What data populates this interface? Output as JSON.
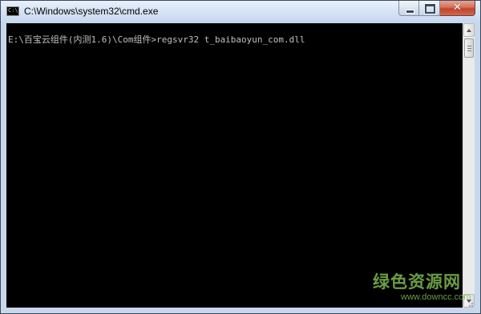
{
  "window": {
    "title": "C:\\Windows\\system32\\cmd.exe",
    "icon": "cmd-icon",
    "caption_buttons": {
      "minimize_icon": "minimize-icon",
      "maximize_icon": "maximize-icon",
      "close_glyph": "✕"
    }
  },
  "console": {
    "lines": [
      "E:\\百宝云组件(内测1.6)\\Com组件>regsvr32 t_baibaoyun_com.dll"
    ],
    "background": "#000000",
    "foreground": "#c0c0c0"
  },
  "watermark": {
    "title": "绿色资源网",
    "url": "www.downcc.com",
    "color": "#7eb950"
  }
}
